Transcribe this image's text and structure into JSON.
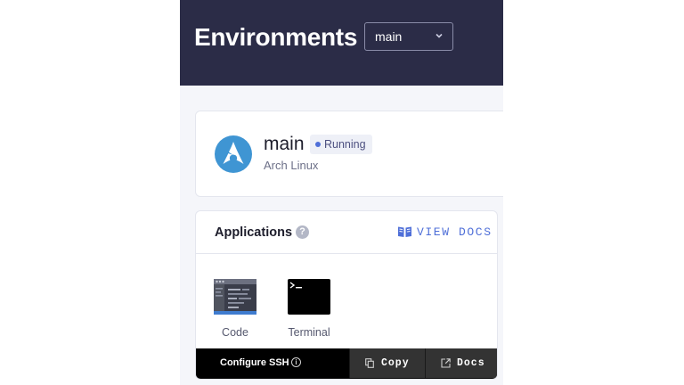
{
  "header": {
    "title": "Environments",
    "env_select_value": "main"
  },
  "environment": {
    "name": "main",
    "status": "Running",
    "os": "Arch Linux",
    "logo_icon": "arch-linux-icon"
  },
  "applications": {
    "title": "Applications",
    "view_docs_label": "VIEW DOCS",
    "apps": [
      {
        "label": "Code",
        "icon": "code-editor-icon"
      },
      {
        "label": "Terminal",
        "icon": "terminal-icon"
      }
    ]
  },
  "ssh": {
    "label": "Configure SSH",
    "copy_label": "Copy",
    "docs_label": "Docs"
  },
  "colors": {
    "header_bg": "#2b2c47",
    "accent": "#4f6fd8",
    "arch_blue": "#3f95d3"
  }
}
